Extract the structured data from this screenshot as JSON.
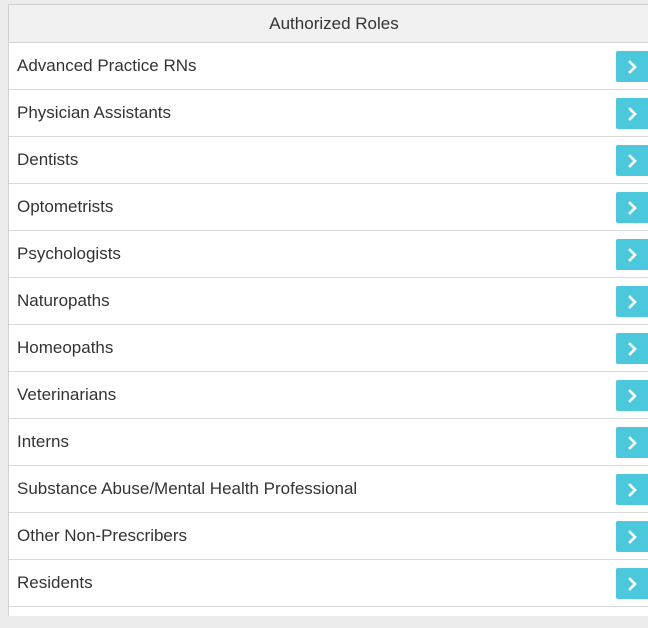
{
  "panel": {
    "title": "Authorized Roles",
    "roles": [
      {
        "label": "Advanced Practice RNs",
        "action_icon": "chevron-right-icon"
      },
      {
        "label": "Physician Assistants",
        "action_icon": "chevron-right-icon"
      },
      {
        "label": "Dentists",
        "action_icon": "chevron-right-icon"
      },
      {
        "label": "Optometrists",
        "action_icon": "chevron-right-icon"
      },
      {
        "label": "Psychologists",
        "action_icon": "chevron-right-icon"
      },
      {
        "label": "Naturopaths",
        "action_icon": "chevron-right-icon"
      },
      {
        "label": "Homeopaths",
        "action_icon": "chevron-right-icon"
      },
      {
        "label": "Veterinarians",
        "action_icon": "chevron-right-icon"
      },
      {
        "label": "Interns",
        "action_icon": "chevron-right-icon"
      },
      {
        "label": "Substance Abuse/Mental Health Professional",
        "action_icon": "chevron-right-icon"
      },
      {
        "label": "Other Non-Prescribers",
        "action_icon": "chevron-right-icon"
      },
      {
        "label": "Residents",
        "action_icon": "chevron-right-icon"
      }
    ]
  },
  "colors": {
    "accent": "#4cc8dc",
    "header_bg": "#f1f1f1",
    "border": "#d2d2d2",
    "text": "#333333"
  }
}
